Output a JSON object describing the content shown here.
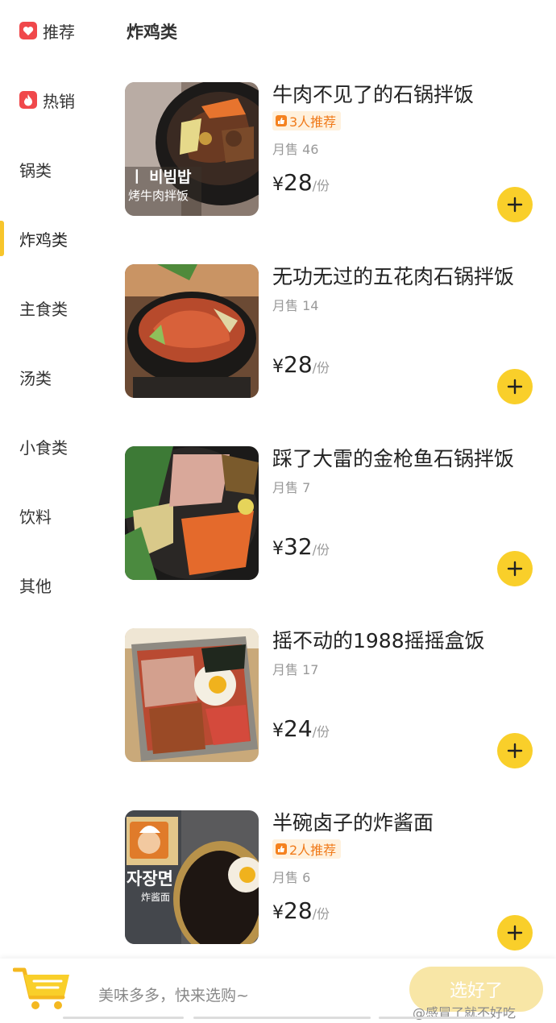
{
  "sidebar": {
    "items": [
      {
        "label": "推荐",
        "icon": "heart-icon"
      },
      {
        "label": "热销",
        "icon": "flame-icon"
      },
      {
        "label": "锅类"
      },
      {
        "label": "炸鸡类",
        "active": true
      },
      {
        "label": "主食类"
      },
      {
        "label": "汤类"
      },
      {
        "label": "小食类"
      },
      {
        "label": "饮料"
      },
      {
        "label": "其他"
      }
    ]
  },
  "section": {
    "title": "炸鸡类"
  },
  "products": [
    {
      "name": "牛肉不见了的石锅拌饭",
      "badge": "3人推荐",
      "sales": "月售 46",
      "currency": "¥",
      "price": "28",
      "unit": "/份"
    },
    {
      "name": "无功无过的五花肉石锅拌饭",
      "sales": "月售 14",
      "currency": "¥",
      "price": "28",
      "unit": "/份"
    },
    {
      "name": "踩了大雷的金枪鱼石锅拌饭",
      "sales": "月售 7",
      "currency": "¥",
      "price": "32",
      "unit": "/份"
    },
    {
      "name": "摇不动的1988摇摇盒饭",
      "sales": "月售 17",
      "currency": "¥",
      "price": "24",
      "unit": "/份"
    },
    {
      "name": "半碗卤子的炸酱面",
      "badge": "2人推荐",
      "sales": "月售 6",
      "currency": "¥",
      "price": "28",
      "unit": "/份"
    }
  ],
  "thumb_text": {
    "p1_line1": "ㅣ 비빔밥",
    "p1_line2": "烤牛肉拌饭",
    "p5_line1": "자장면",
    "p5_line2": "炸酱面"
  },
  "bottom": {
    "cart_hint": "美味多多，快来选购~",
    "submit_label": "选好了",
    "watermark": "@感冒了就不好吃"
  },
  "colors": {
    "accent": "#f9cf2a",
    "badge_bg": "#fff1dd",
    "badge_text": "#f07a1a",
    "heart": "#f0484b"
  }
}
